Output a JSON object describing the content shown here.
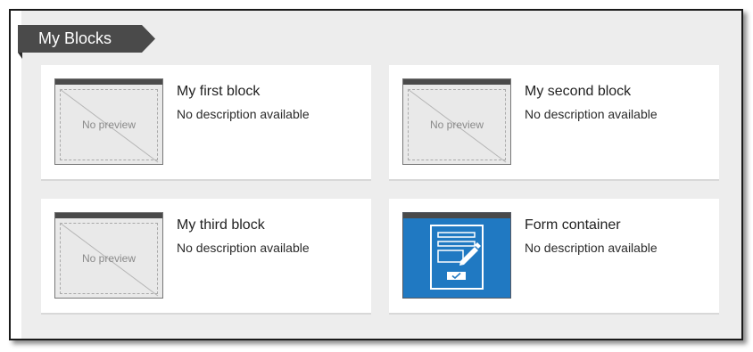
{
  "section": {
    "title": "My Blocks"
  },
  "blocks": [
    {
      "title": "My first block",
      "description": "No description available",
      "preview": "No preview",
      "thumbnail_icon": "no-preview"
    },
    {
      "title": "My second block",
      "description": "No description available",
      "preview": "No preview",
      "thumbnail_icon": "no-preview"
    },
    {
      "title": "My third block",
      "description": "No description available",
      "preview": "No preview",
      "thumbnail_icon": "no-preview"
    },
    {
      "title": "Form container",
      "description": "No description available",
      "thumbnail_icon": "form-edit-icon"
    }
  ],
  "colors": {
    "tab_background": "#4a4a4a",
    "panel_background": "#ededed",
    "card_background": "#ffffff",
    "form_thumbnail": "#2079c2"
  }
}
